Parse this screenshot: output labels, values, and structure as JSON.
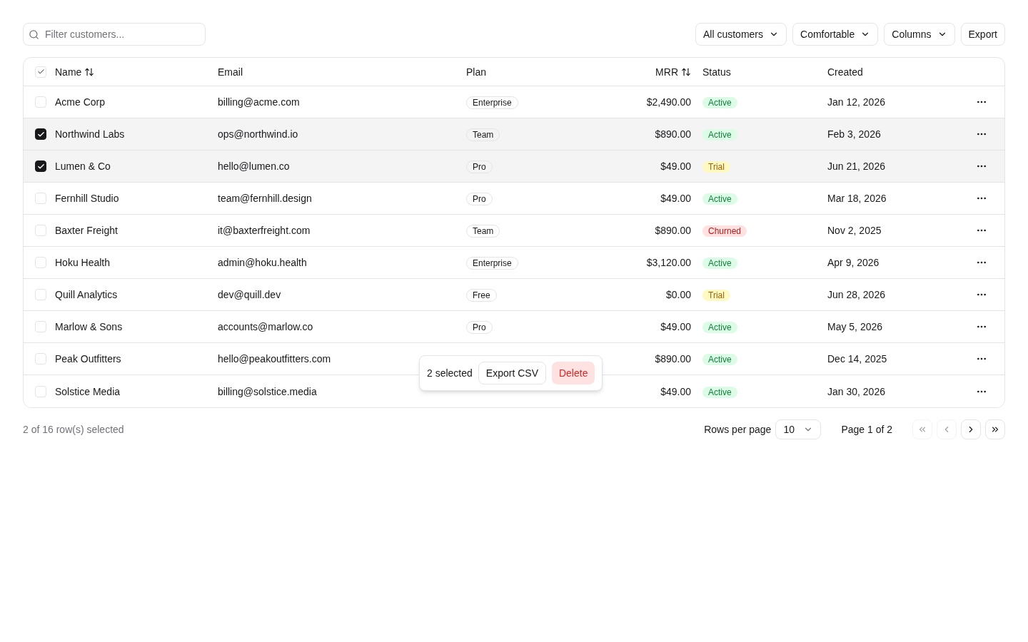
{
  "toolbar": {
    "search": {
      "placeholder": "Filter customers..."
    },
    "dropdowns": [
      {
        "label": "All customers"
      },
      {
        "label": "Comfortable"
      },
      {
        "label": "Columns"
      }
    ],
    "export_button": "Export"
  },
  "table": {
    "header_checkbox": {
      "indeterminate": true
    },
    "columns": [
      {
        "label": "Name",
        "sortable": true
      },
      {
        "label": "Email",
        "sortable": false
      },
      {
        "label": "Plan",
        "sortable": false
      },
      {
        "label": "MRR",
        "sortable": true
      },
      {
        "label": "Status",
        "sortable": false
      },
      {
        "label": "Created",
        "sortable": false
      }
    ],
    "rows": [
      {
        "selected": false,
        "name": "Acme Corp",
        "email": "billing@acme.com",
        "plan": "Enterprise",
        "mrr": "$2,490.00",
        "status": {
          "label": "Active",
          "kind": "active"
        },
        "created": "Jan 12, 2026"
      },
      {
        "selected": true,
        "name": "Northwind Labs",
        "email": "ops@northwind.io",
        "plan": "Team",
        "mrr": "$890.00",
        "status": {
          "label": "Active",
          "kind": "active"
        },
        "created": "Feb 3, 2026"
      },
      {
        "selected": true,
        "name": "Lumen & Co",
        "email": "hello@lumen.co",
        "plan": "Pro",
        "mrr": "$49.00",
        "status": {
          "label": "Trial",
          "kind": "trial"
        },
        "created": "Jun 21, 2026"
      },
      {
        "selected": false,
        "name": "Fernhill Studio",
        "email": "team@fernhill.design",
        "plan": "Pro",
        "mrr": "$49.00",
        "status": {
          "label": "Active",
          "kind": "active"
        },
        "created": "Mar 18, 2026"
      },
      {
        "selected": false,
        "name": "Baxter Freight",
        "email": "it@baxterfreight.com",
        "plan": "Team",
        "mrr": "$890.00",
        "status": {
          "label": "Churned",
          "kind": "churned"
        },
        "created": "Nov 2, 2025"
      },
      {
        "selected": false,
        "name": "Hoku Health",
        "email": "admin@hoku.health",
        "plan": "Enterprise",
        "mrr": "$3,120.00",
        "status": {
          "label": "Active",
          "kind": "active"
        },
        "created": "Apr 9, 2026"
      },
      {
        "selected": false,
        "name": "Quill Analytics",
        "email": "dev@quill.dev",
        "plan": "Free",
        "mrr": "$0.00",
        "status": {
          "label": "Trial",
          "kind": "trial"
        },
        "created": "Jun 28, 2026"
      },
      {
        "selected": false,
        "name": "Marlow & Sons",
        "email": "accounts@marlow.co",
        "plan": "Pro",
        "mrr": "$49.00",
        "status": {
          "label": "Active",
          "kind": "active"
        },
        "created": "May 5, 2026"
      },
      {
        "selected": false,
        "name": "Peak Outfitters",
        "email": "hello@peakoutfitters.com",
        "mrr": "$890.00",
        "status": {
          "label": "Active",
          "kind": "active"
        },
        "created": "Dec 14, 2025"
      },
      {
        "selected": false,
        "name": "Solstice Media",
        "email": "billing@solstice.media",
        "mrr": "$49.00",
        "status": {
          "label": "Active",
          "kind": "active"
        },
        "created": "Jan 30, 2026"
      }
    ]
  },
  "selection_bar": {
    "count": "2 selected",
    "export_button": "Export CSV",
    "delete_button": "Delete"
  },
  "footer": {
    "selection_text": "2 of 16 row(s) selected",
    "rows_per_page_label": "Rows per page",
    "rows_per_page_value": "10",
    "page_text": "Page 1 of 2",
    "pager": [
      {
        "kind": "first",
        "disabled": true
      },
      {
        "kind": "prev",
        "disabled": true
      },
      {
        "kind": "next",
        "disabled": false
      },
      {
        "kind": "last",
        "disabled": false
      }
    ]
  }
}
